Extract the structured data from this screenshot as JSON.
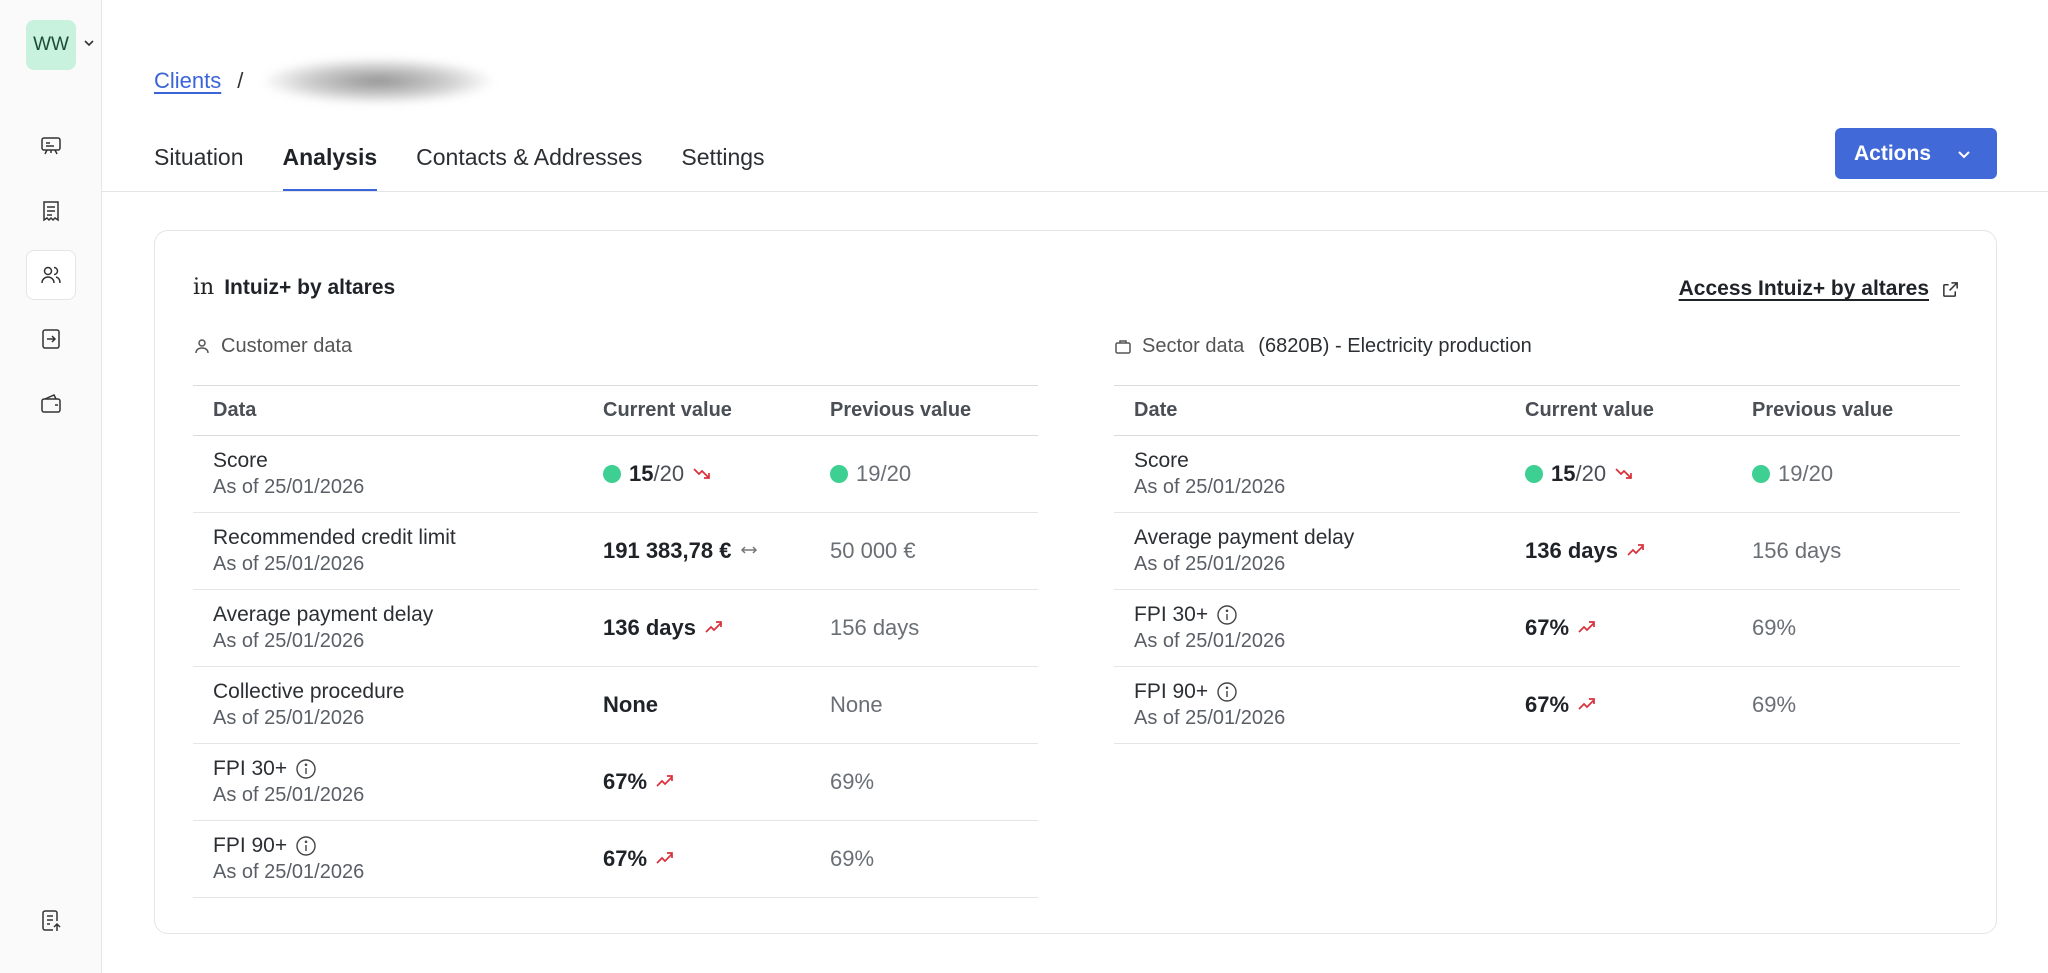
{
  "sidebar": {
    "avatar": "WW",
    "colors": {
      "avatar_bg": "#c8f2dd"
    },
    "icons": [
      "presentation-icon",
      "invoice-icon",
      "users-icon",
      "transfer-icon",
      "wallet-icon",
      "export-report-icon"
    ],
    "active_item": "users-icon"
  },
  "header": {
    "breadcrumb_root": "Clients",
    "breadcrumb_sep": "/",
    "tabs": [
      "Situation",
      "Analysis",
      "Contacts & Addresses",
      "Settings"
    ],
    "active_tab": "Analysis",
    "actions_label": "Actions"
  },
  "card": {
    "provider_logo": "in",
    "provider_name": "Intuiz+ by altares",
    "access_link": "Access Intuiz+ by altares",
    "customer": {
      "heading": "Customer data",
      "columns": [
        "Data",
        "Current value",
        "Previous value"
      ],
      "rows": [
        {
          "label": "Score",
          "date": "As of 25/01/2026",
          "current_main": "15",
          "current_denom": "/20",
          "previous": "19/20",
          "dot": true,
          "trend": "down"
        },
        {
          "label": "Recommended credit limit",
          "date": "As of 25/01/2026",
          "current_main": "191 383,78 €",
          "current_denom": "",
          "previous": "50 000 €",
          "dot": false,
          "trend": "flat"
        },
        {
          "label": "Average payment delay",
          "date": "As of 25/01/2026",
          "current_main": "136 days",
          "current_denom": "",
          "previous": "156 days",
          "dot": false,
          "trend": "up"
        },
        {
          "label": "Collective procedure",
          "date": "As of 25/01/2026",
          "current_main": "None",
          "current_denom": "",
          "previous": "None",
          "dot": false,
          "trend": "none"
        },
        {
          "label": "FPI 30+",
          "date": "As of 25/01/2026",
          "current_main": "67%",
          "current_denom": "",
          "previous": "69%",
          "dot": false,
          "trend": "up",
          "info": true
        },
        {
          "label": "FPI 90+",
          "date": "As of 25/01/2026",
          "current_main": "67%",
          "current_denom": "",
          "previous": "69%",
          "dot": false,
          "trend": "up",
          "info": true
        }
      ]
    },
    "sector": {
      "heading": "Sector data",
      "code": "(6820B) - Electricity production",
      "columns": [
        "Date",
        "Current value",
        "Previous value"
      ],
      "rows": [
        {
          "label": "Score",
          "date": "As of 25/01/2026",
          "current_main": "15",
          "current_denom": "/20",
          "previous": "19/20",
          "dot": true,
          "trend": "down"
        },
        {
          "label": "Average payment delay",
          "date": "As of 25/01/2026",
          "current_main": "136 days",
          "current_denom": "",
          "previous": "156 days",
          "dot": false,
          "trend": "up"
        },
        {
          "label": "FPI 30+",
          "date": "As of 25/01/2026",
          "current_main": "67%",
          "current_denom": "",
          "previous": "69%",
          "dot": false,
          "trend": "up",
          "info": true
        },
        {
          "label": "FPI 90+",
          "date": "As of 25/01/2026",
          "current_main": "67%",
          "current_denom": "",
          "previous": "69%",
          "dot": false,
          "trend": "up",
          "info": true
        }
      ]
    }
  },
  "colors": {
    "accent": "#4169d7",
    "score_dot": "#3ecf93",
    "trend_red": "#d9303a"
  }
}
